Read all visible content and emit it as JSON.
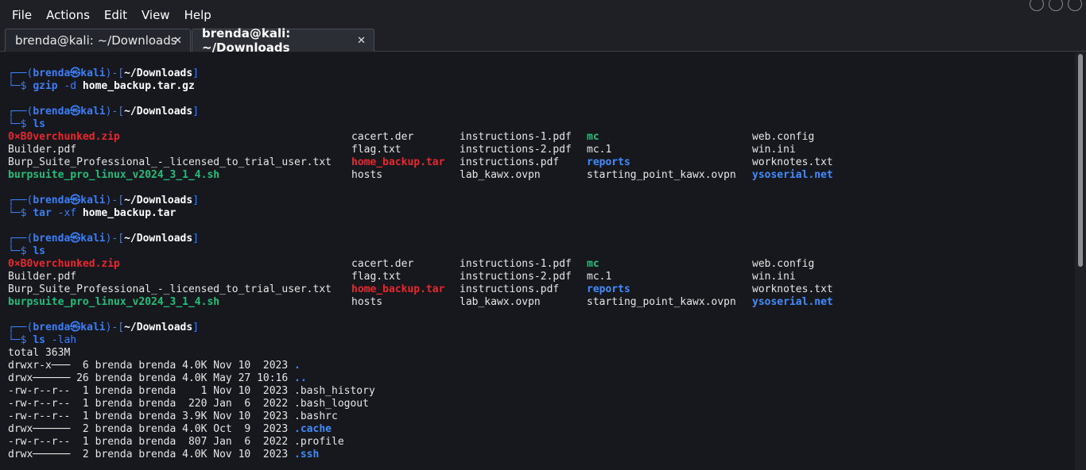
{
  "menubar": {
    "items": [
      "File",
      "Actions",
      "Edit",
      "View",
      "Help"
    ]
  },
  "tabs": [
    {
      "label": "brenda@kali: ~/Downloads",
      "close": "✕",
      "active": false
    },
    {
      "label": "brenda@kali: ~/Downloads",
      "close": "✕",
      "active": true
    }
  ],
  "prompt": {
    "top_left": "┌──(",
    "user": "brenda",
    "at": "㉿",
    "host": "kali",
    "mid": ")-[",
    "cwd": "~/Downloads",
    "end": "]",
    "bottom": "└─$ "
  },
  "blocks": [
    {
      "type": "prompt",
      "cmd": "gzip",
      "args": "-d",
      "target": "home_backup.tar.gz"
    },
    {
      "type": "prompt",
      "cmd": "ls",
      "args": "",
      "target": ""
    },
    {
      "type": "ls",
      "rows": [
        [
          {
            "t": "0×B0verchunked.zip",
            "c": "red"
          },
          {
            "t": "cacert.der",
            "c": "text"
          },
          {
            "t": "instructions-1.pdf",
            "c": "text"
          },
          {
            "t": "mc",
            "c": "green"
          },
          {
            "t": "web.config",
            "c": "text"
          }
        ],
        [
          {
            "t": "Builder.pdf",
            "c": "text"
          },
          {
            "t": "flag.txt",
            "c": "text"
          },
          {
            "t": "instructions-2.pdf",
            "c": "text"
          },
          {
            "t": "mc.1",
            "c": "text"
          },
          {
            "t": "win.ini",
            "c": "text"
          }
        ],
        [
          {
            "t": "Burp_Suite_Professional_-_licensed_to_trial_user.txt",
            "c": "text"
          },
          {
            "t": "home_backup.tar",
            "c": "red"
          },
          {
            "t": "instructions.pdf",
            "c": "text"
          },
          {
            "t": "reports",
            "c": "dir"
          },
          {
            "t": "worknotes.txt",
            "c": "text"
          }
        ],
        [
          {
            "t": "burpsuite_pro_linux_v2024_3_1_4.sh",
            "c": "green"
          },
          {
            "t": "hosts",
            "c": "text"
          },
          {
            "t": "lab_kawx.ovpn",
            "c": "text"
          },
          {
            "t": "starting_point_kawx.ovpn",
            "c": "text"
          },
          {
            "t": "ysoserial.net",
            "c": "dir"
          }
        ]
      ]
    },
    {
      "type": "prompt",
      "cmd": "tar",
      "args": "-xf",
      "target": "home_backup.tar"
    },
    {
      "type": "prompt",
      "cmd": "ls",
      "args": "",
      "target": ""
    },
    {
      "type": "ls",
      "rows": [
        [
          {
            "t": "0×B0verchunked.zip",
            "c": "red"
          },
          {
            "t": "cacert.der",
            "c": "text"
          },
          {
            "t": "instructions-1.pdf",
            "c": "text"
          },
          {
            "t": "mc",
            "c": "green"
          },
          {
            "t": "web.config",
            "c": "text"
          }
        ],
        [
          {
            "t": "Builder.pdf",
            "c": "text"
          },
          {
            "t": "flag.txt",
            "c": "text"
          },
          {
            "t": "instructions-2.pdf",
            "c": "text"
          },
          {
            "t": "mc.1",
            "c": "text"
          },
          {
            "t": "win.ini",
            "c": "text"
          }
        ],
        [
          {
            "t": "Burp_Suite_Professional_-_licensed_to_trial_user.txt",
            "c": "text"
          },
          {
            "t": "home_backup.tar",
            "c": "red"
          },
          {
            "t": "instructions.pdf",
            "c": "text"
          },
          {
            "t": "reports",
            "c": "dir"
          },
          {
            "t": "worknotes.txt",
            "c": "text"
          }
        ],
        [
          {
            "t": "burpsuite_pro_linux_v2024_3_1_4.sh",
            "c": "green"
          },
          {
            "t": "hosts",
            "c": "text"
          },
          {
            "t": "lab_kawx.ovpn",
            "c": "text"
          },
          {
            "t": "starting_point_kawx.ovpn",
            "c": "text"
          },
          {
            "t": "ysoserial.net",
            "c": "dir"
          }
        ]
      ]
    },
    {
      "type": "prompt",
      "cmd": "ls",
      "args": "-lah",
      "target": ""
    },
    {
      "type": "lah",
      "total": "total 363M",
      "rows": [
        {
          "meta": "drwxr-x───  6 brenda brenda 4.0K Nov 10  2023 ",
          "name": ".",
          "c": "dir"
        },
        {
          "meta": "drwx────── 26 brenda brenda 4.0K May 27 10:16 ",
          "name": "..",
          "c": "dir"
        },
        {
          "meta": "-rw-r--r--  1 brenda brenda    1 Nov 10  2023 ",
          "name": ".bash_history",
          "c": "text"
        },
        {
          "meta": "-rw-r--r--  1 brenda brenda  220 Jan  6  2022 ",
          "name": ".bash_logout",
          "c": "text"
        },
        {
          "meta": "-rw-r--r--  1 brenda brenda 3.9K Nov 10  2023 ",
          "name": ".bashrc",
          "c": "text"
        },
        {
          "meta": "drwx──────  2 brenda brenda 4.0K Oct  9  2023 ",
          "name": ".cache",
          "c": "dir"
        },
        {
          "meta": "-rw-r--r--  1 brenda brenda  807 Jan  6  2022 ",
          "name": ".profile",
          "c": "text"
        },
        {
          "meta": "drwx──────  2 brenda brenda 4.0K Nov 10  2023 ",
          "name": ".ssh",
          "c": "dir"
        }
      ]
    }
  ],
  "colors": {
    "prompt_frame": "#3b7ef6",
    "archive": "#e8272e",
    "executable": "#1fbf7a",
    "directory": "#3f8cff",
    "text": "#e6e6e6"
  },
  "icons": {
    "tab_close": "close-icon"
  }
}
